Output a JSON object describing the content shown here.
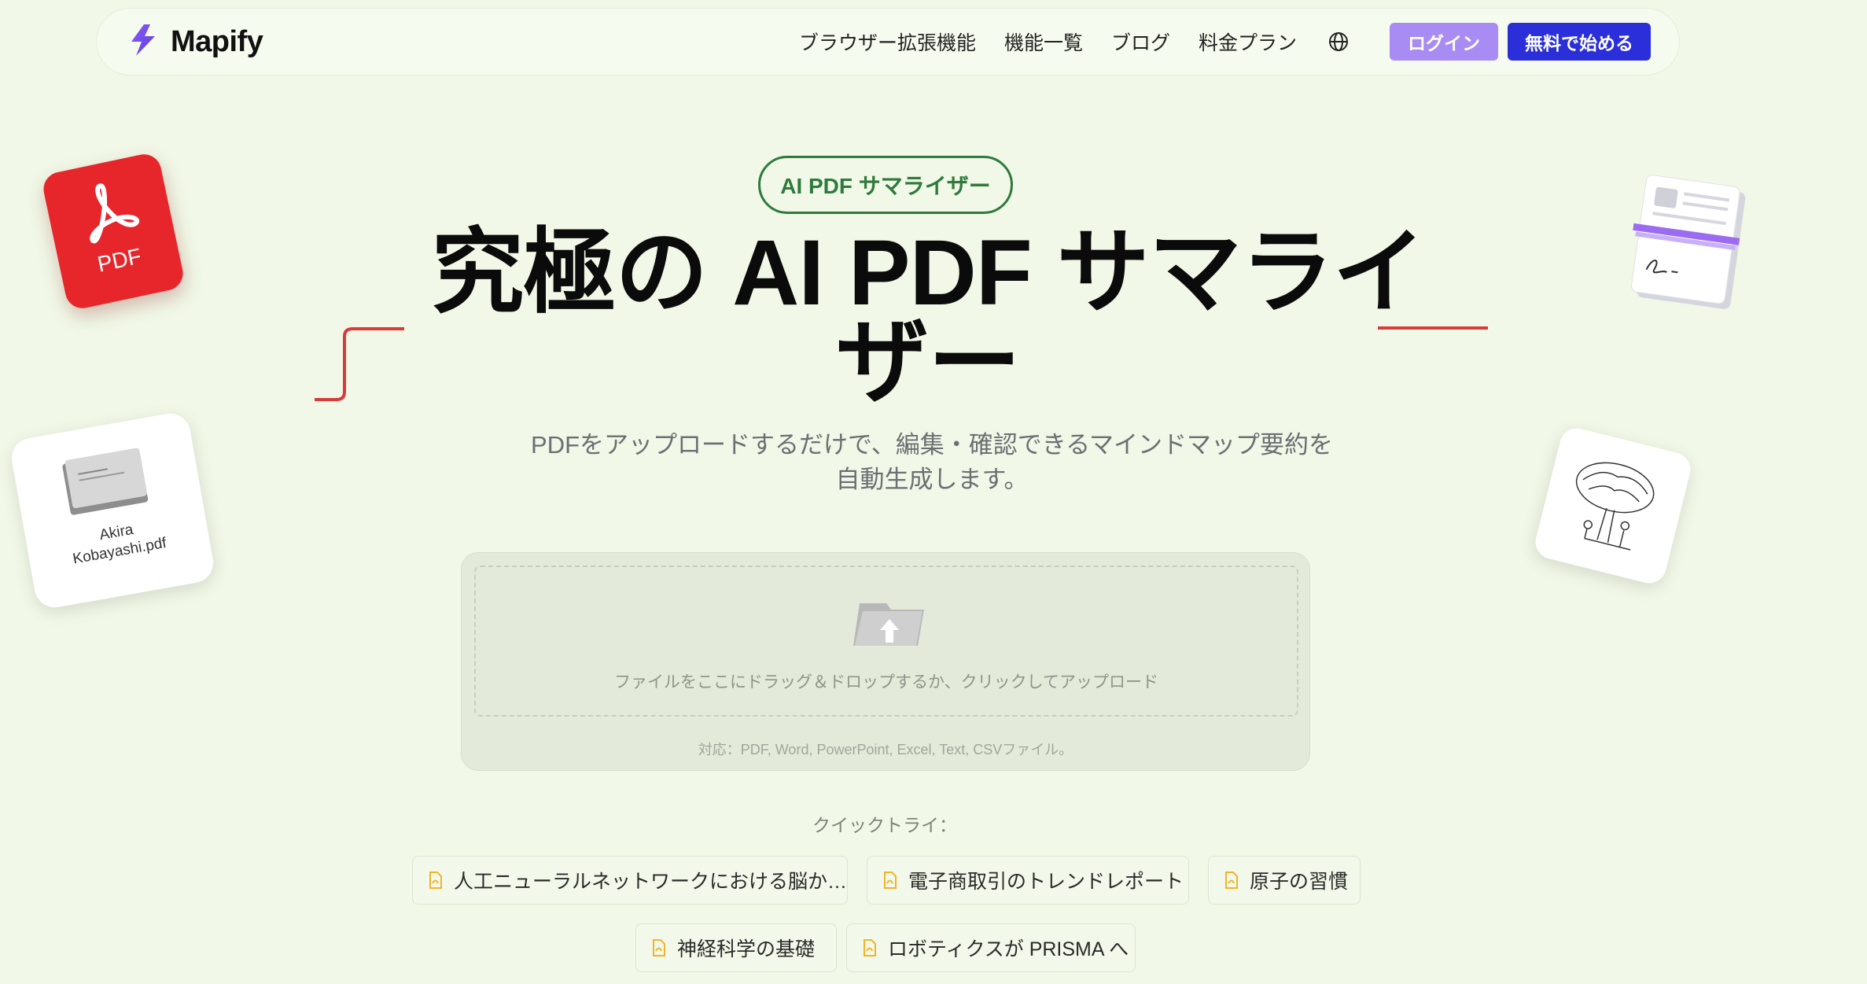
{
  "nav": {
    "brand": "Mapify",
    "links": [
      "ブラウザー拡張機能",
      "機能一覧",
      "ブログ",
      "料金プラン"
    ],
    "login": "ログイン",
    "start": "無料で始める"
  },
  "hero": {
    "badge": "AI PDF サマライザー",
    "title_line1": "究極の AI PDF サマライ",
    "title_line2": "ザー",
    "subtitle_line1": "PDFをアップロードするだけで、編集・確認できるマインドマップ要約を",
    "subtitle_line2": "自動生成します。"
  },
  "upload": {
    "drop_text": "ファイルをここにドラッグ＆ドロップするか、クリックしてアップロード",
    "formats": "対応：PDF, Word, PowerPoint, Excel, Text, CSVファイル。"
  },
  "quick_try": {
    "label": "クイックトライ：",
    "items": [
      "人工ニューラルネットワークにおける脳か…",
      "電子商取引のトレンドレポート",
      "原子の習慣",
      "神経科学の基礎",
      "ロボティクスが PRISMA へ"
    ]
  },
  "decor": {
    "file_card_line1": "Akira",
    "file_card_line2": "Kobayashi.pdf",
    "pdf_tile_label": "PDF"
  },
  "colors": {
    "background": "#f1f8e7",
    "accent_purple": "#a98cf3",
    "accent_blue": "#2b2fd9",
    "badge_green": "#2f7a3c",
    "pdf_red": "#e7262b",
    "chip_icon_yellow": "#f0b429",
    "deco_line_red": "#d93a3a"
  },
  "icons": {
    "logo": "lightning-bolt-icon",
    "language": "globe-icon",
    "upload": "upload-folder-icon",
    "chip": "pdf-file-icon"
  }
}
